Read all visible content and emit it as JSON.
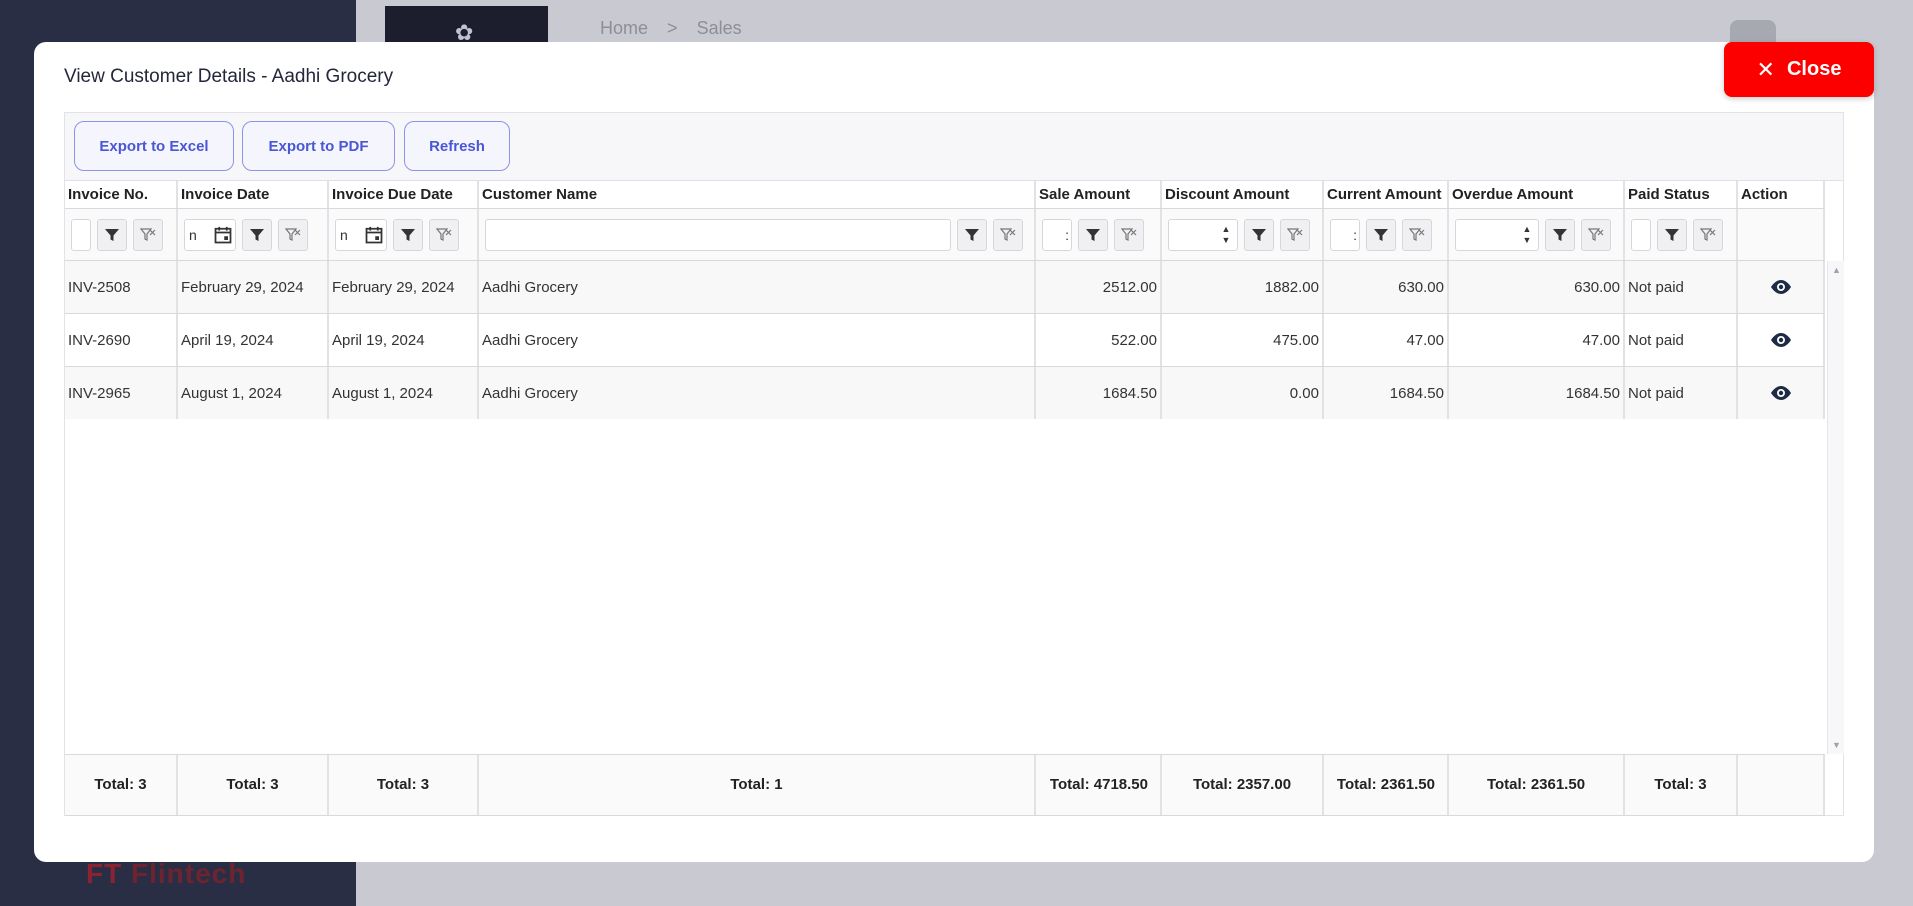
{
  "background": {
    "breadcrumb": [
      "Home",
      ">",
      "Sales"
    ],
    "brand": "Flintech"
  },
  "modal": {
    "title": "View Customer Details - Aadhi Grocery",
    "close_label": "Close"
  },
  "toolbar": {
    "export_excel": "Export to Excel",
    "export_pdf": "Export to PDF",
    "refresh": "Refresh"
  },
  "columns": [
    "Invoice No.",
    "Invoice Date",
    "Invoice Due Date",
    "Customer Name",
    "Sale Amount",
    "Discount Amount",
    "Current Amount",
    "Overdue Amount",
    "Paid Status",
    "Action"
  ],
  "filters": {
    "date_placeholder": "n",
    "amount_placeholder": ":"
  },
  "rows": [
    [
      "INV-2508",
      "February 29, 2024",
      "February 29, 2024",
      "Aadhi Grocery",
      "2512.00",
      "1882.00",
      "630.00",
      "630.00",
      "Not paid"
    ],
    [
      "INV-2690",
      "April 19, 2024",
      "April 19, 2024",
      "Aadhi Grocery",
      "522.00",
      "475.00",
      "47.00",
      "47.00",
      "Not paid"
    ],
    [
      "INV-2965",
      "August 1, 2024",
      "August 1, 2024",
      "Aadhi Grocery",
      "1684.50",
      "0.00",
      "1684.50",
      "1684.50",
      "Not paid"
    ]
  ],
  "totals": [
    "Total: 3",
    "Total: 3",
    "Total: 3",
    "Total: 1",
    "Total: 4718.50",
    "Total: 2357.00",
    "Total: 2361.50",
    "Total: 2361.50",
    "Total: 3"
  ]
}
